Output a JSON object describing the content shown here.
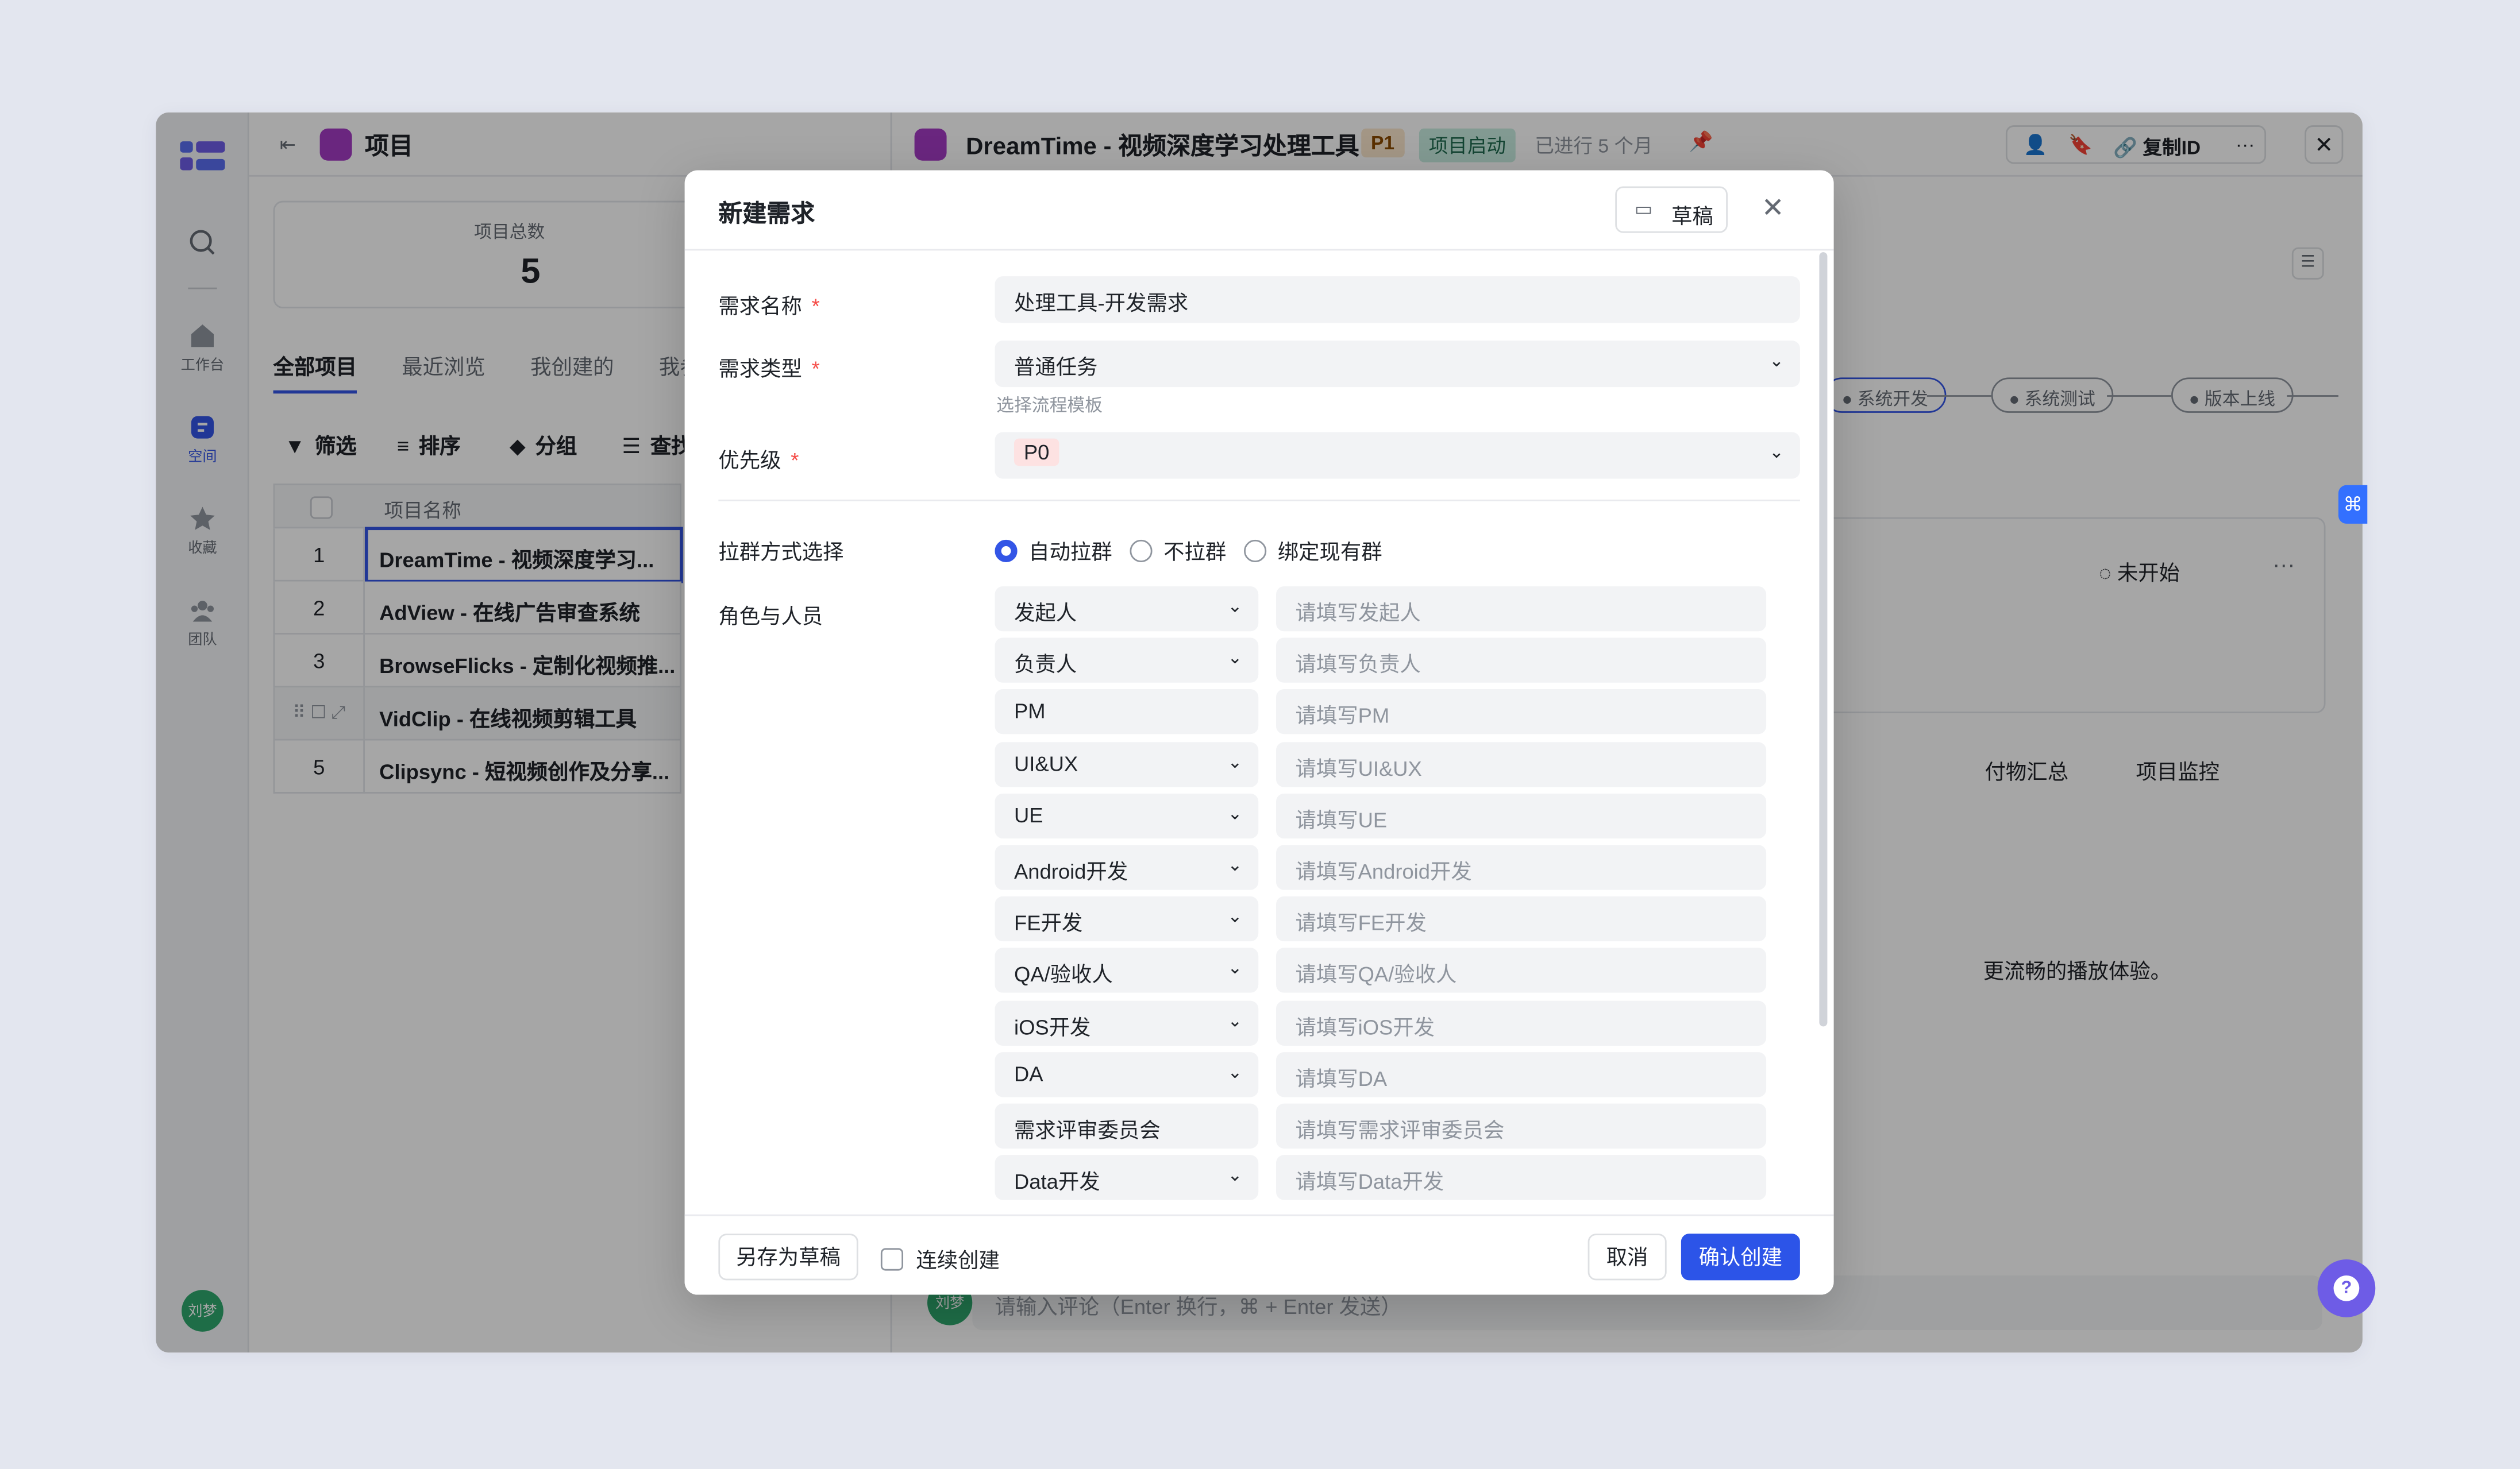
{
  "sidebar": {
    "items": [
      {
        "label": "工作台",
        "icon": "home-icon"
      },
      {
        "label": "空间",
        "icon": "space-icon"
      },
      {
        "label": "收藏",
        "icon": "star-icon"
      },
      {
        "label": "团队",
        "icon": "team-icon"
      }
    ],
    "avatar": "刘梦"
  },
  "projects": {
    "title": "项目",
    "stat_label": "项目总数",
    "stat_value": "5",
    "tabs": [
      "全部项目",
      "最近浏览",
      "我创建的",
      "我参"
    ],
    "toolbar": [
      "筛选",
      "排序",
      "分组",
      "查找"
    ],
    "column": "项目名称",
    "rows": [
      {
        "idx": "1",
        "name": "DreamTime - 视频深度学习..."
      },
      {
        "idx": "2",
        "name": "AdView - 在线广告审查系统"
      },
      {
        "idx": "3",
        "name": "BrowseFlicks - 定制化视频推..."
      },
      {
        "idx": "4",
        "name": "VidClip - 在线视频剪辑工具"
      },
      {
        "idx": "5",
        "name": "Clipsync - 短视频创作及分享..."
      }
    ]
  },
  "detail": {
    "title": "DreamTime - 视频深度学习处理工具",
    "priority": "P1",
    "stage": "项目启动",
    "elapsed": "已进行 5 个月",
    "copy_id": "复制ID",
    "steps": [
      "系统开发",
      "系统测试",
      "版本上线"
    ],
    "task_status": "未开始",
    "tabs": [
      "付物汇总",
      "项目监控"
    ],
    "desc_fragment": "更流畅的播放体验。",
    "comment_placeholder": "请输入评论（Enter 换行，⌘ + Enter 发送）",
    "comment_avatar": "刘梦"
  },
  "modal": {
    "title": "新建需求",
    "draft_label": "草稿",
    "name_label": "需求名称",
    "name_value": "处理工具-开发需求",
    "type_label": "需求类型",
    "type_value": "普通任务",
    "type_hint": "选择流程模板",
    "priority_label": "优先级",
    "priority_value": "P0",
    "group_label": "拉群方式选择",
    "group_options": [
      "自动拉群",
      "不拉群",
      "绑定现有群"
    ],
    "group_selected": "自动拉群",
    "roles_label": "角色与人员",
    "roles": [
      {
        "role": "发起人",
        "placeholder": "请填写发起人",
        "dropdown": true
      },
      {
        "role": "负责人",
        "placeholder": "请填写负责人",
        "dropdown": true
      },
      {
        "role": "PM",
        "placeholder": "请填写PM",
        "dropdown": false
      },
      {
        "role": "UI&UX",
        "placeholder": "请填写UI&UX",
        "dropdown": true
      },
      {
        "role": "UE",
        "placeholder": "请填写UE",
        "dropdown": true
      },
      {
        "role": "Android开发",
        "placeholder": "请填写Android开发",
        "dropdown": true
      },
      {
        "role": "FE开发",
        "placeholder": "请填写FE开发",
        "dropdown": true
      },
      {
        "role": "QA/验收人",
        "placeholder": "请填写QA/验收人",
        "dropdown": true
      },
      {
        "role": "iOS开发",
        "placeholder": "请填写iOS开发",
        "dropdown": true
      },
      {
        "role": "DA",
        "placeholder": "请填写DA",
        "dropdown": true
      },
      {
        "role": "需求评审委员会",
        "placeholder": "请填写需求评审委员会",
        "dropdown": false
      },
      {
        "role": "Data开发",
        "placeholder": "请填写Data开发",
        "dropdown": true
      }
    ],
    "save_draft": "另存为草稿",
    "continuous": "连续创建",
    "cancel": "取消",
    "confirm": "确认创建"
  },
  "colors": {
    "accent": "#2c54e8",
    "purple": "#a43bc4",
    "danger": "#f54a45"
  }
}
